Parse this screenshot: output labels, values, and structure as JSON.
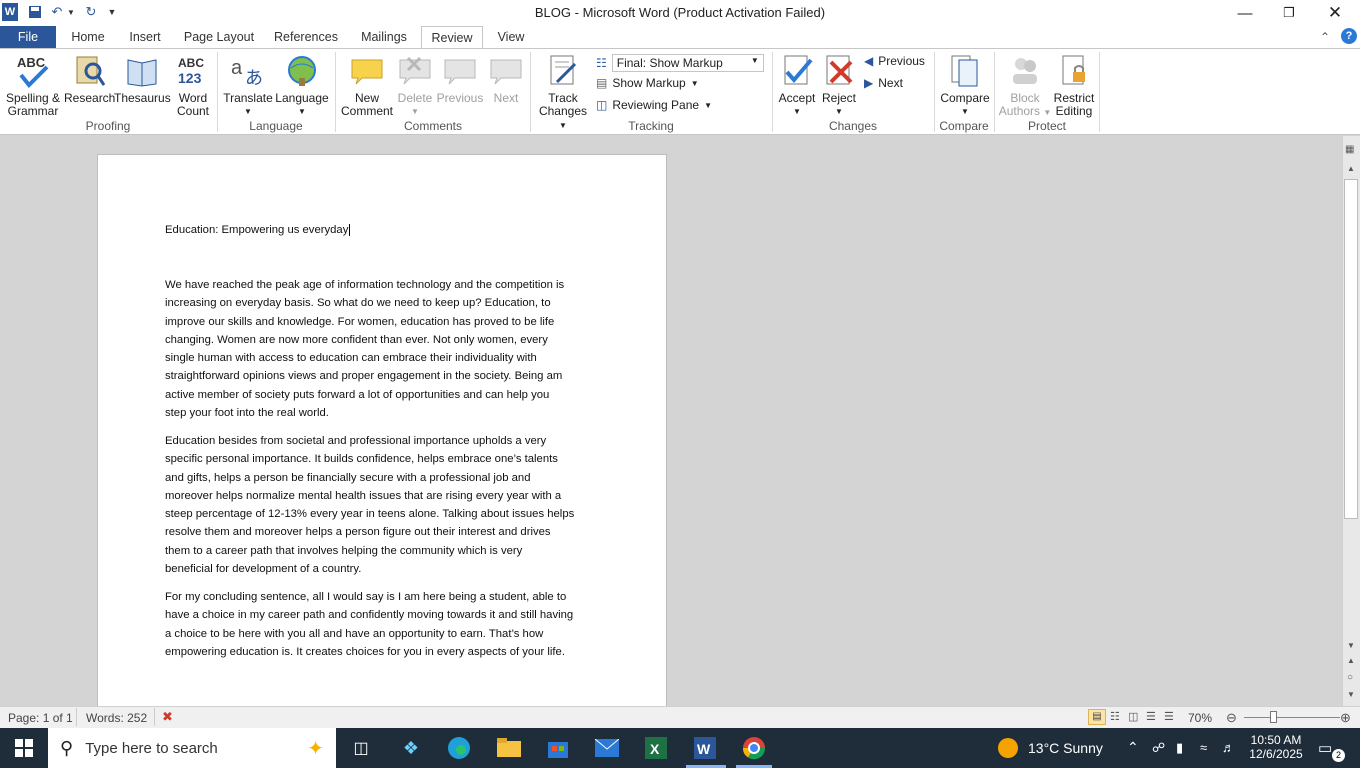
{
  "window": {
    "title": "BLOG - Microsoft Word (Product Activation Failed)"
  },
  "tabs": [
    "File",
    "Home",
    "Insert",
    "Page Layout",
    "References",
    "Mailings",
    "Review",
    "View"
  ],
  "ribbon": {
    "proofing": {
      "spelling": "Spelling &",
      "spelling2": "Grammar",
      "research": "Research",
      "thesaurus": "Thesaurus",
      "wordcount": "Word",
      "wordcount2": "Count",
      "group": "Proofing"
    },
    "language": {
      "translate": "Translate",
      "language": "Language",
      "group": "Language"
    },
    "comments": {
      "new": "New",
      "new2": "Comment",
      "delete": "Delete",
      "previous": "Previous",
      "next": "Next",
      "group": "Comments"
    },
    "tracking": {
      "track": "Track",
      "track2": "Changes",
      "markup_select": "Final: Show Markup",
      "show_markup": "Show Markup",
      "reviewing_pane": "Reviewing Pane",
      "group": "Tracking"
    },
    "changes": {
      "accept": "Accept",
      "reject": "Reject",
      "previous": "Previous",
      "next": "Next",
      "group": "Changes"
    },
    "compare": {
      "compare": "Compare",
      "group": "Compare"
    },
    "protect": {
      "block": "Block",
      "block2": "Authors",
      "restrict": "Restrict",
      "restrict2": "Editing",
      "group": "Protect"
    }
  },
  "document": {
    "title": "Education: Empowering us everyday",
    "paragraphs": [
      [
        "We have reached the peak age of information technology and the competition is",
        "increasing on everyday basis. So what do we need to keep up? Education, to",
        "improve our skills and knowledge. For women, education has proved to be life",
        "changing. Women are now more confident than ever. Not only women, every",
        "single human with access to education can embrace their individuality with",
        "straightforward opinions views and proper engagement in the society. Being am",
        "active member of society puts forward a lot of opportunities and can help you",
        "step your foot into the real world."
      ],
      [
        "Education besides from societal and professional importance upholds a very",
        "specific personal importance. It builds confidence, helps embrace one’s talents",
        "and gifts, helps a person be financially secure with a professional job and",
        "moreover helps normalize mental health issues that are rising every year with a",
        "steep percentage of 12-13% every year in teens alone. Talking about issues helps",
        "resolve them and moreover helps a person figure out their interest and drives",
        "them to a career path that involves helping the community which is very",
        "beneficial for development of a country."
      ],
      [
        "For my concluding sentence, all I would say is I am here being a student, able to",
        "have a choice in my career path and confidently moving towards it and still having",
        "a choice to be here with you all and have an opportunity to earn. That’s how",
        "empowering education is. It creates choices for you in every aspects of your life."
      ]
    ]
  },
  "status": {
    "page": "Page: 1 of 1",
    "words": "Words: 252",
    "zoom": "70%"
  },
  "taskbar": {
    "search_placeholder": "Type here to search",
    "weather": "13°C  Sunny",
    "time": "10:50 AM",
    "date": "12/6/2025",
    "notif_count": "2"
  }
}
